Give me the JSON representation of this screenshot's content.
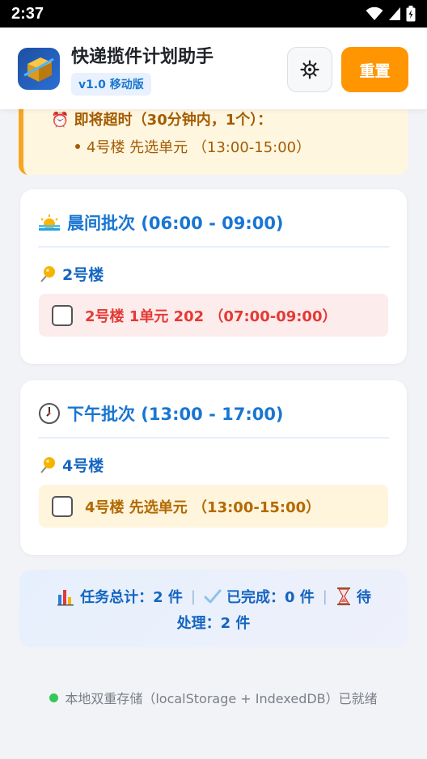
{
  "status_bar": {
    "time": "2:37"
  },
  "header": {
    "title": "快递揽件计划助手",
    "version": "v1.0 移动版",
    "reset_label": "重置"
  },
  "alert": {
    "title": "⏰ 即将超时（30分钟内，1个）：",
    "items": [
      "4号楼 先选单元 （13:00-15:00）"
    ]
  },
  "batches": [
    {
      "title": "晨间批次 (06:00 - 09:00)",
      "icon": "sunrise-icon",
      "building": "2号楼",
      "tasks": [
        {
          "text": "2号楼 1单元 202 （07:00-09:00）",
          "checked": false,
          "color": "#e53935",
          "bg": "#fdecec"
        }
      ]
    },
    {
      "title": "下午批次 (13:00 - 17:00)",
      "icon": "clock-icon",
      "building": "4号楼",
      "tasks": [
        {
          "text": "4号楼 先选单元 （13:00-15:00）",
          "checked": false,
          "color": "#b26a00",
          "bg": "#fff4dc"
        }
      ]
    }
  ],
  "summary": {
    "total": "任务总计：2 件",
    "completed": "已完成：0 件",
    "pending_a": "待",
    "pending_b": "处理：2 件"
  },
  "storage": {
    "text": "本地双重存储（localStorage + IndexedDB）已就绪"
  },
  "colors": {
    "accent": "#1976d2",
    "reset": "#ff9500",
    "alert_border": "#f5a623"
  }
}
